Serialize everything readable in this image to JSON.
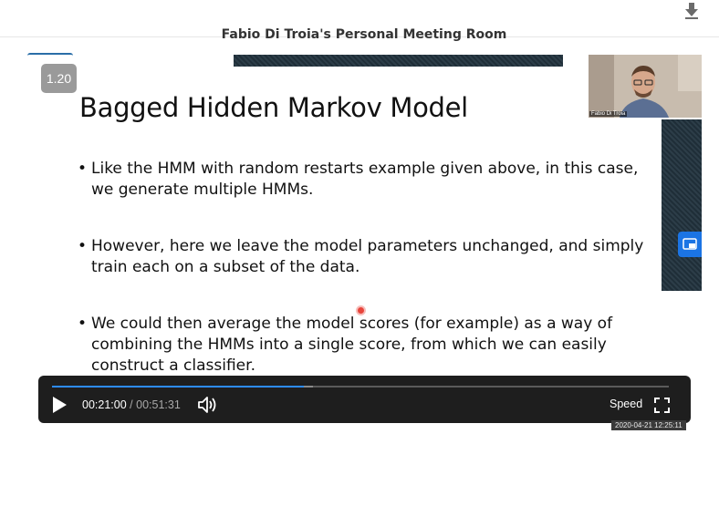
{
  "header": {
    "meeting_title": "Fabio Di Troia's Personal Meeting Room",
    "download_icon": "download-arrow-icon"
  },
  "slide": {
    "number": "1.20",
    "title": "Bagged Hidden Markov Model",
    "bullets": [
      "Like the HMM with random restarts example given above, in this case, we generate multiple HMMs.",
      "However, here we leave the model parameters unchanged, and simply train each on a subset of the data.",
      "We could then average the model scores (for example) as a way of combining the HMMs into a single score, from which we can easily construct a classifier."
    ]
  },
  "webcam": {
    "name": "Fabio Di Troia"
  },
  "player": {
    "current_time": "00:21:00",
    "separator": "/",
    "duration": "00:51:31",
    "progress": 0.408,
    "buffered": 0.423,
    "speed_label": "Speed",
    "accent_color": "#2d8cff"
  },
  "recording_timestamp": "2020-04-21 12:25:11"
}
